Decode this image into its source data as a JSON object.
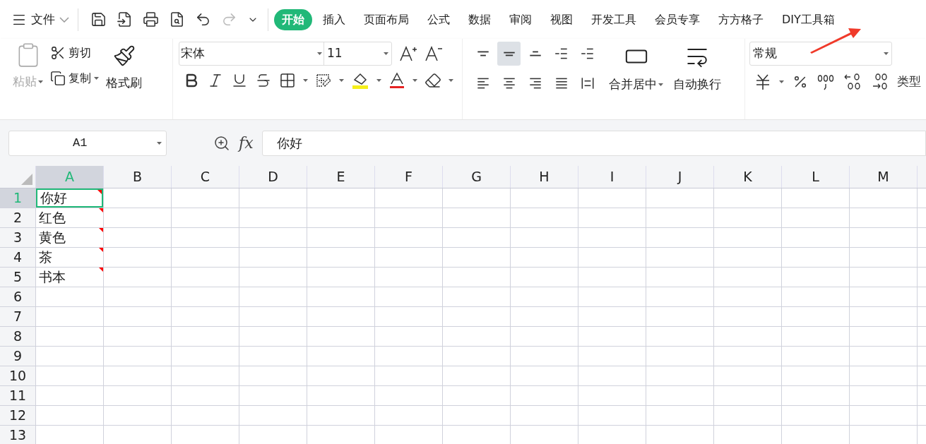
{
  "menu": {
    "label": "文件"
  },
  "quick_access": [
    {
      "kind": "save",
      "disabled": false
    },
    {
      "kind": "export",
      "disabled": false
    },
    {
      "kind": "print",
      "disabled": false
    },
    {
      "kind": "preview",
      "disabled": false
    },
    {
      "kind": "undo",
      "disabled": false
    },
    {
      "kind": "redo",
      "disabled": true
    },
    {
      "kind": "more",
      "disabled": false
    }
  ],
  "tabs": [
    {
      "label": "开始",
      "selected": true
    },
    {
      "label": "插入",
      "selected": false
    },
    {
      "label": "页面布局",
      "selected": false
    },
    {
      "label": "公式",
      "selected": false
    },
    {
      "label": "数据",
      "selected": false
    },
    {
      "label": "审阅",
      "selected": false
    },
    {
      "label": "视图",
      "selected": false
    },
    {
      "label": "开发工具",
      "selected": false
    },
    {
      "label": "会员专享",
      "selected": false
    },
    {
      "label": "方方格子",
      "selected": false
    },
    {
      "label": "DIY工具箱",
      "selected": false
    }
  ],
  "clipboard": {
    "paste": "粘贴",
    "paste_disabled": true,
    "cut": "剪切",
    "copy": "复制",
    "format_painter": "格式刷"
  },
  "font": {
    "name": "宋体",
    "size": "11"
  },
  "alignment": [
    {
      "kind": "top",
      "selected": false
    },
    {
      "kind": "middle",
      "selected": true
    },
    {
      "kind": "bottom",
      "selected": false
    },
    {
      "kind": "outdent",
      "selected": false
    },
    {
      "kind": "indent",
      "selected": false
    },
    {
      "kind": "left",
      "selected": false
    },
    {
      "kind": "center",
      "selected": false
    },
    {
      "kind": "right",
      "selected": false
    },
    {
      "kind": "justify",
      "selected": false
    },
    {
      "kind": "distribute",
      "selected": false
    }
  ],
  "merge": "合并居中",
  "wrap": "自动换行",
  "number": {
    "format": "常规",
    "type_label": "类型"
  },
  "name_box": "A1",
  "function_label": "fx",
  "formula": "你好",
  "columns": [
    {
      "label": "A",
      "selected": true
    },
    {
      "label": "B",
      "selected": false
    },
    {
      "label": "C",
      "selected": false
    },
    {
      "label": "D",
      "selected": false
    },
    {
      "label": "E",
      "selected": false
    },
    {
      "label": "F",
      "selected": false
    },
    {
      "label": "G",
      "selected": false
    },
    {
      "label": "H",
      "selected": false
    },
    {
      "label": "I",
      "selected": false
    },
    {
      "label": "J",
      "selected": false
    },
    {
      "label": "K",
      "selected": false
    },
    {
      "label": "L",
      "selected": false
    },
    {
      "label": "M",
      "selected": false
    }
  ],
  "rows": [
    {
      "label": "1",
      "selected": true,
      "cell": {
        "text": "你好",
        "active": true,
        "comment": true
      }
    },
    {
      "label": "2",
      "selected": false,
      "cell": {
        "text": "红色",
        "active": false,
        "comment": true
      }
    },
    {
      "label": "3",
      "selected": false,
      "cell": {
        "text": "黄色",
        "active": false,
        "comment": true
      }
    },
    {
      "label": "4",
      "selected": false,
      "cell": {
        "text": "茶",
        "active": false,
        "comment": true
      }
    },
    {
      "label": "5",
      "selected": false,
      "cell": {
        "text": "书本",
        "active": false,
        "comment": true
      }
    },
    {
      "label": "6",
      "selected": false
    },
    {
      "label": "7",
      "selected": false
    },
    {
      "label": "8",
      "selected": false
    },
    {
      "label": "9",
      "selected": false
    },
    {
      "label": "10",
      "selected": false
    },
    {
      "label": "11",
      "selected": false
    },
    {
      "label": "12",
      "selected": false
    },
    {
      "label": "13",
      "selected": false
    }
  ]
}
